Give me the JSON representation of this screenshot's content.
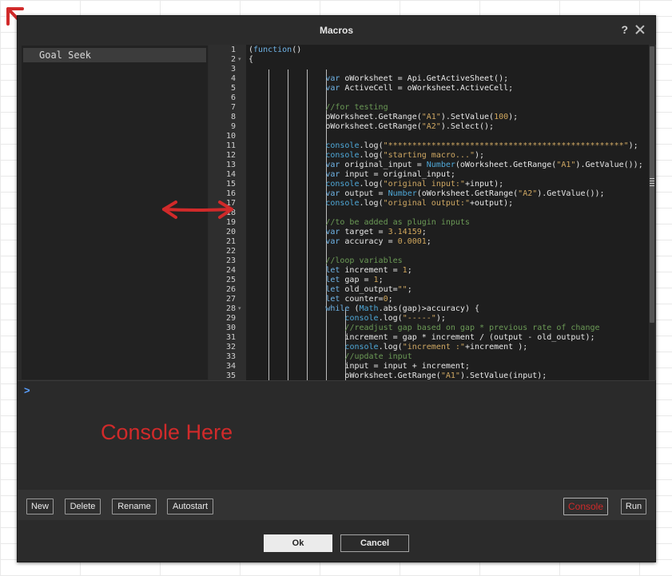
{
  "dialog": {
    "title": "Macros",
    "help_glyph": "?",
    "icons": [
      "help-icon",
      "close-icon"
    ]
  },
  "macros": {
    "items": [
      {
        "label": "Goal Seek",
        "selected": true
      }
    ]
  },
  "editor": {
    "lines": [
      {
        "n": "1",
        "fold": false,
        "tokens": [
          [
            "(",
            "plain"
          ],
          [
            "function",
            "kw"
          ],
          [
            "()",
            "plain"
          ]
        ]
      },
      {
        "n": "2",
        "fold": true,
        "tokens": [
          [
            "{",
            "plain"
          ]
        ]
      },
      {
        "n": "3",
        "fold": false,
        "tokens": []
      },
      {
        "n": "4",
        "fold": false,
        "tokens": [
          [
            "                ",
            "plain"
          ],
          [
            "var",
            "kw"
          ],
          [
            " oWorksheet = Api.GetActiveSheet();",
            "plain"
          ]
        ]
      },
      {
        "n": "5",
        "fold": false,
        "tokens": [
          [
            "                ",
            "plain"
          ],
          [
            "var",
            "kw"
          ],
          [
            " ActiveCell = oWorksheet.ActiveCell;",
            "plain"
          ]
        ]
      },
      {
        "n": "6",
        "fold": false,
        "tokens": []
      },
      {
        "n": "7",
        "fold": false,
        "tokens": [
          [
            "                ",
            "plain"
          ],
          [
            "//for testing",
            "cmt"
          ]
        ]
      },
      {
        "n": "8",
        "fold": false,
        "tokens": [
          [
            "                ",
            "plain"
          ],
          [
            "oWorksheet.GetRange(",
            "plain"
          ],
          [
            "\"A1\"",
            "str"
          ],
          [
            ").SetValue(",
            "plain"
          ],
          [
            "100",
            "num"
          ],
          [
            ");",
            "plain"
          ]
        ]
      },
      {
        "n": "9",
        "fold": false,
        "tokens": [
          [
            "                ",
            "plain"
          ],
          [
            "oWorksheet.GetRange(",
            "plain"
          ],
          [
            "\"A2\"",
            "str"
          ],
          [
            ").Select();",
            "plain"
          ]
        ]
      },
      {
        "n": "10",
        "fold": false,
        "tokens": []
      },
      {
        "n": "11",
        "fold": false,
        "tokens": [
          [
            "                ",
            "plain"
          ],
          [
            "console",
            "fn"
          ],
          [
            ".log(",
            "plain"
          ],
          [
            "\"*************************************************\"",
            "str"
          ],
          [
            ");",
            "plain"
          ]
        ]
      },
      {
        "n": "12",
        "fold": false,
        "tokens": [
          [
            "                ",
            "plain"
          ],
          [
            "console",
            "fn"
          ],
          [
            ".log(",
            "plain"
          ],
          [
            "\"starting macro...\"",
            "str"
          ],
          [
            ");",
            "plain"
          ]
        ]
      },
      {
        "n": "13",
        "fold": false,
        "tokens": [
          [
            "                ",
            "plain"
          ],
          [
            "var",
            "kw"
          ],
          [
            " original_input = ",
            "plain"
          ],
          [
            "Number",
            "fn"
          ],
          [
            "(oWorksheet.GetRange(",
            "plain"
          ],
          [
            "\"A1\"",
            "str"
          ],
          [
            ").GetValue());",
            "plain"
          ]
        ]
      },
      {
        "n": "14",
        "fold": false,
        "tokens": [
          [
            "                ",
            "plain"
          ],
          [
            "var",
            "kw"
          ],
          [
            " input = original_input;",
            "plain"
          ]
        ]
      },
      {
        "n": "15",
        "fold": false,
        "tokens": [
          [
            "                ",
            "plain"
          ],
          [
            "console",
            "fn"
          ],
          [
            ".log(",
            "plain"
          ],
          [
            "\"original input:\"",
            "str"
          ],
          [
            "+input);",
            "plain"
          ]
        ]
      },
      {
        "n": "16",
        "fold": false,
        "tokens": [
          [
            "                ",
            "plain"
          ],
          [
            "var",
            "kw"
          ],
          [
            " output = ",
            "plain"
          ],
          [
            "Number",
            "fn"
          ],
          [
            "(oWorksheet.GetRange(",
            "plain"
          ],
          [
            "\"A2\"",
            "str"
          ],
          [
            ").GetValue());",
            "plain"
          ]
        ]
      },
      {
        "n": "17",
        "fold": false,
        "tokens": [
          [
            "                ",
            "plain"
          ],
          [
            "console",
            "fn"
          ],
          [
            ".log(",
            "plain"
          ],
          [
            "\"original output:\"",
            "str"
          ],
          [
            "+output);",
            "plain"
          ]
        ]
      },
      {
        "n": "18",
        "fold": false,
        "tokens": []
      },
      {
        "n": "19",
        "fold": false,
        "tokens": [
          [
            "                ",
            "plain"
          ],
          [
            "//to be added as plugin inputs",
            "cmt"
          ]
        ]
      },
      {
        "n": "20",
        "fold": false,
        "tokens": [
          [
            "                ",
            "plain"
          ],
          [
            "var",
            "kw"
          ],
          [
            " target = ",
            "plain"
          ],
          [
            "3.14159",
            "num"
          ],
          [
            ";",
            "plain"
          ]
        ]
      },
      {
        "n": "21",
        "fold": false,
        "tokens": [
          [
            "                ",
            "plain"
          ],
          [
            "var",
            "kw"
          ],
          [
            " accuracy = ",
            "plain"
          ],
          [
            "0.0001",
            "num"
          ],
          [
            ";",
            "plain"
          ]
        ]
      },
      {
        "n": "22",
        "fold": false,
        "tokens": []
      },
      {
        "n": "23",
        "fold": false,
        "tokens": [
          [
            "                ",
            "plain"
          ],
          [
            "//loop variables",
            "cmt"
          ]
        ]
      },
      {
        "n": "24",
        "fold": false,
        "tokens": [
          [
            "                ",
            "plain"
          ],
          [
            "let",
            "kw"
          ],
          [
            " increment = ",
            "plain"
          ],
          [
            "1",
            "num"
          ],
          [
            ";",
            "plain"
          ]
        ]
      },
      {
        "n": "25",
        "fold": false,
        "tokens": [
          [
            "                ",
            "plain"
          ],
          [
            "let",
            "kw"
          ],
          [
            " gap = ",
            "plain"
          ],
          [
            "1",
            "num"
          ],
          [
            ";",
            "plain"
          ]
        ]
      },
      {
        "n": "26",
        "fold": false,
        "tokens": [
          [
            "                ",
            "plain"
          ],
          [
            "let",
            "kw"
          ],
          [
            " old_output=",
            "plain"
          ],
          [
            "\"\"",
            "str"
          ],
          [
            ";",
            "plain"
          ]
        ]
      },
      {
        "n": "27",
        "fold": false,
        "tokens": [
          [
            "                ",
            "plain"
          ],
          [
            "let",
            "kw"
          ],
          [
            " counter=",
            "plain"
          ],
          [
            "0",
            "num"
          ],
          [
            ";",
            "plain"
          ]
        ]
      },
      {
        "n": "28",
        "fold": true,
        "tokens": [
          [
            "                ",
            "plain"
          ],
          [
            "while",
            "kw"
          ],
          [
            " (",
            "plain"
          ],
          [
            "Math",
            "fn"
          ],
          [
            ".abs(gap)>accuracy) {",
            "plain"
          ]
        ]
      },
      {
        "n": "29",
        "fold": false,
        "tokens": [
          [
            "                    ",
            "plain"
          ],
          [
            "console",
            "fn"
          ],
          [
            ".log(",
            "plain"
          ],
          [
            "\"-----\"",
            "str"
          ],
          [
            ");",
            "plain"
          ]
        ]
      },
      {
        "n": "30",
        "fold": false,
        "tokens": [
          [
            "                    ",
            "plain"
          ],
          [
            "//readjust gap based on gap * previous rate of change",
            "cmt"
          ]
        ]
      },
      {
        "n": "31",
        "fold": false,
        "tokens": [
          [
            "                    ",
            "plain"
          ],
          [
            "increment = gap * increment / (output - old_output);",
            "plain"
          ]
        ]
      },
      {
        "n": "32",
        "fold": false,
        "tokens": [
          [
            "                    ",
            "plain"
          ],
          [
            "console",
            "fn"
          ],
          [
            ".log(",
            "plain"
          ],
          [
            "\"increment :\"",
            "str"
          ],
          [
            "+increment );",
            "plain"
          ]
        ]
      },
      {
        "n": "33",
        "fold": false,
        "tokens": [
          [
            "                    ",
            "plain"
          ],
          [
            "//update input",
            "cmt"
          ]
        ]
      },
      {
        "n": "34",
        "fold": false,
        "tokens": [
          [
            "                    ",
            "plain"
          ],
          [
            "input = input + increment;",
            "plain"
          ]
        ]
      },
      {
        "n": "35",
        "fold": false,
        "tokens": [
          [
            "                    ",
            "plain"
          ],
          [
            "oWorksheet.GetRange(",
            "plain"
          ],
          [
            "\"A1\"",
            "str"
          ],
          [
            ").SetValue(input);",
            "plain"
          ]
        ]
      }
    ]
  },
  "console": {
    "prompt": ">",
    "annotation": "Console Here"
  },
  "toolbar": {
    "new_label": "New",
    "delete_label": "Delete",
    "rename_label": "Rename",
    "autostart_label": "Autostart",
    "console_label": "Console",
    "run_label": "Run"
  },
  "footer": {
    "ok_label": "Ok",
    "cancel_label": "Cancel"
  },
  "colors": {
    "dialog_bg": "#2b2b2b",
    "keyword": "#6fb3e6",
    "string": "#cfa863",
    "comment": "#6b9a56",
    "annotation_red": "#d12a2a",
    "console_prompt": "#5aa0ff"
  }
}
